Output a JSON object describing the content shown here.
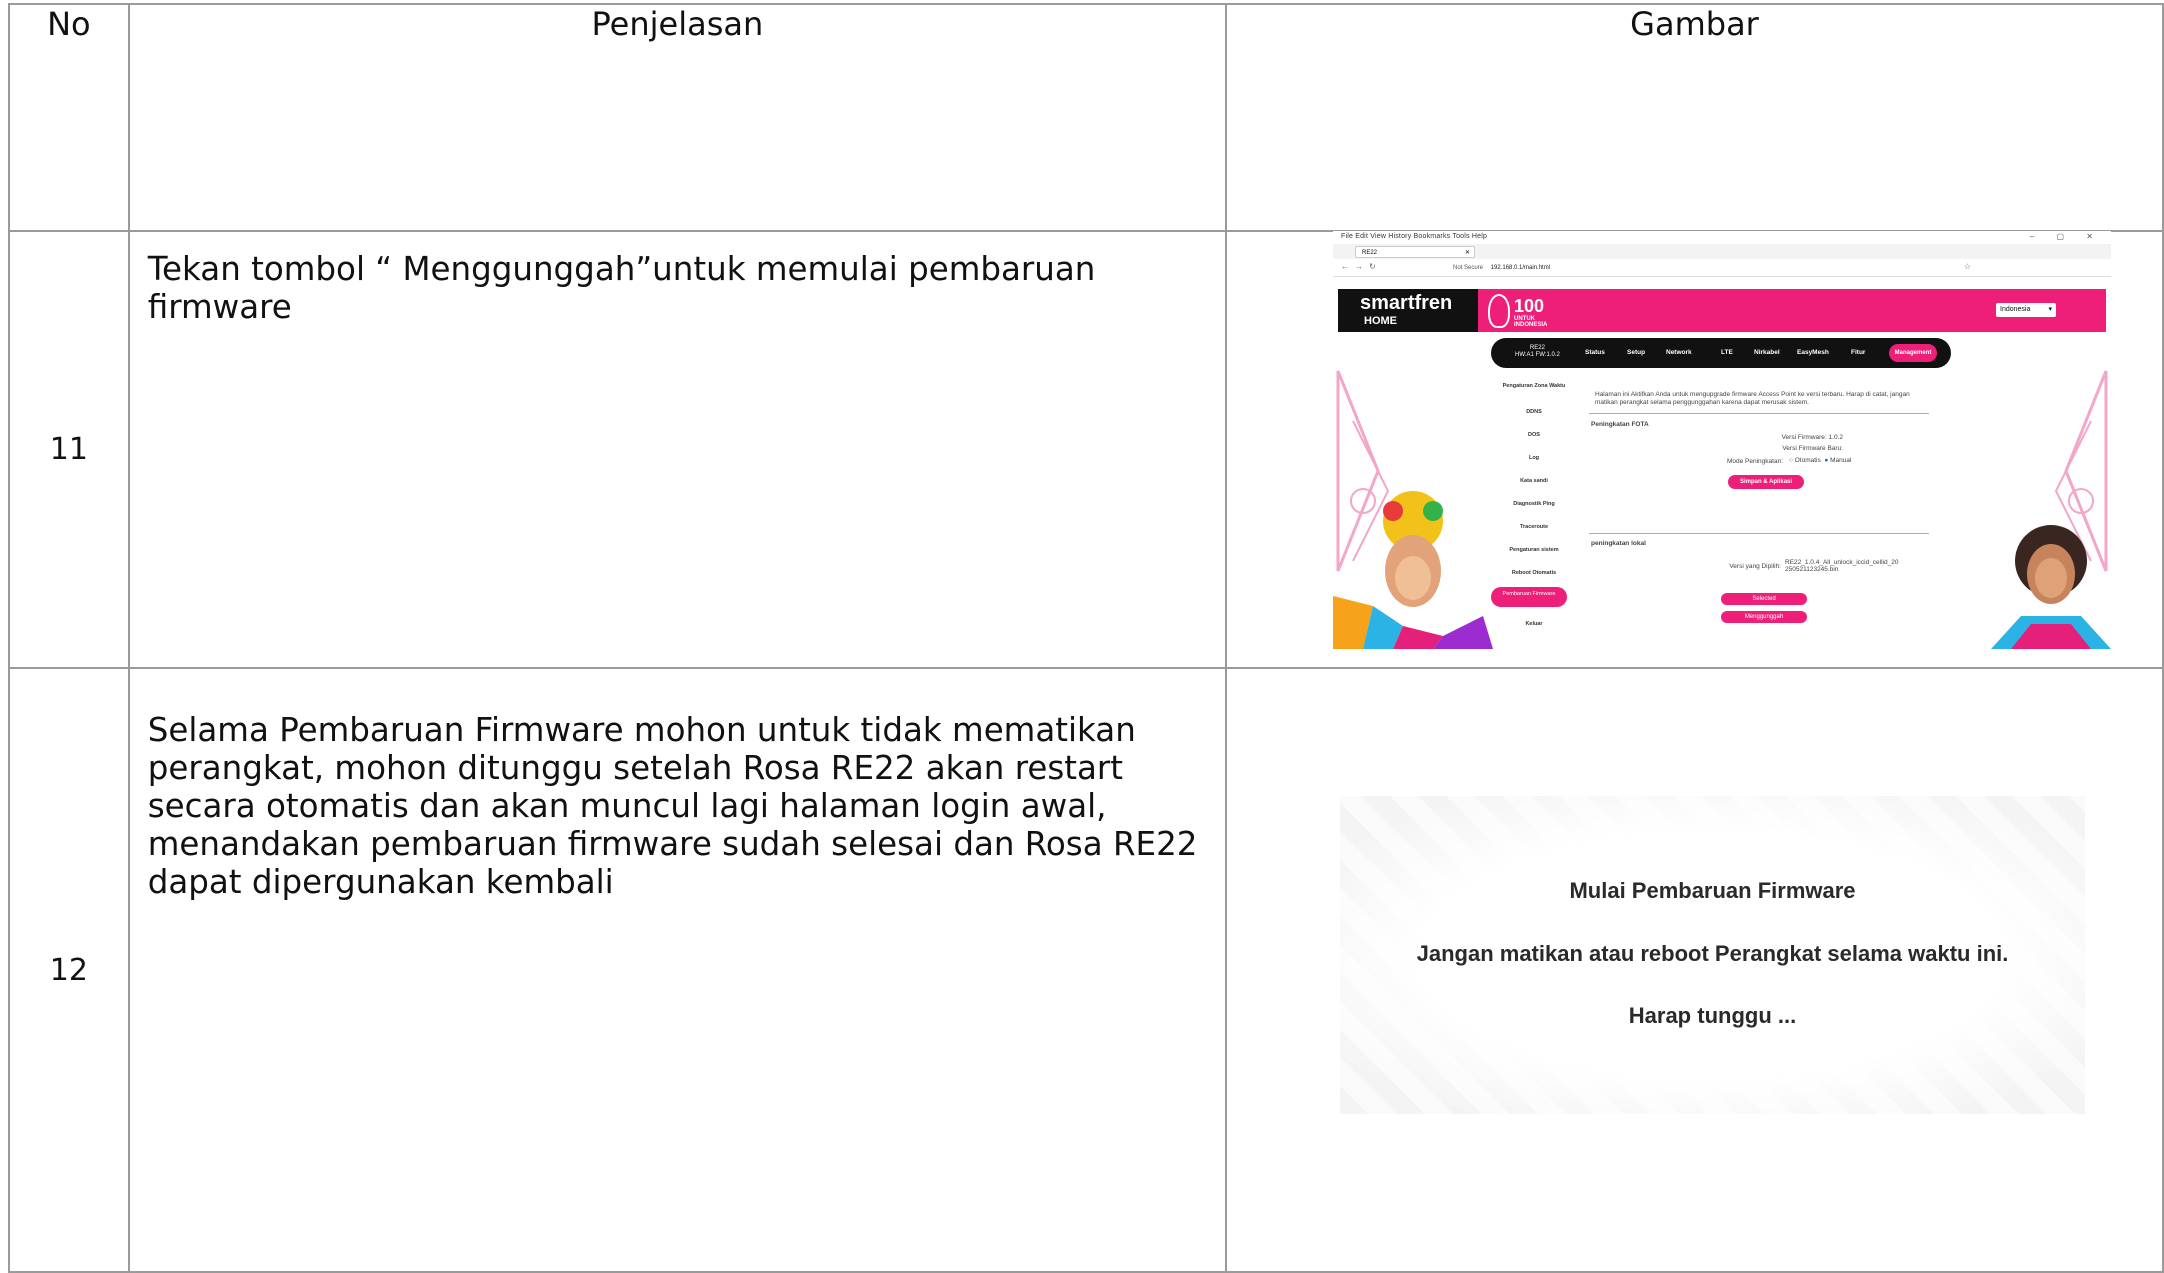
{
  "table": {
    "headers": {
      "no": "No",
      "description": "Penjelasan",
      "image": "Gambar"
    },
    "rows": [
      {
        "no": "11",
        "description": "Tekan tombol “ Menggunggah”untuk memulai pembaruan firmware"
      },
      {
        "no": "12",
        "description": "Selama Pembaruan Firmware mohon untuk tidak mematikan perangkat, mohon ditunggu setelah Rosa RE22 akan restart secara otomatis dan akan muncul lagi halaman login awal, menandakan pembaruan firmware sudah selesai dan Rosa RE22 dapat dipergunakan kembali"
      }
    ]
  },
  "screenshot1": {
    "browser": {
      "menu": "File  Edit  View  History  Bookmarks  Tools  Help",
      "tab_title": "RE22",
      "not_secure": "Not Secure",
      "url": "192.168.0.1/main.html"
    },
    "brand": {
      "name": "smartfren",
      "sub": "HOME",
      "badge_num": "100",
      "badge_text": "UNTUK INDONESIA"
    },
    "language": "Indonesia",
    "model": {
      "name": "RE22",
      "version": "HW:A1  FW:1.0.2"
    },
    "nav": [
      "Status",
      "Setup",
      "Network",
      "LTE",
      "Nirkabel",
      "EasyMesh",
      "Fitur",
      "Management"
    ],
    "sidebar": [
      "Pengaturan Zona Waktu",
      "DDNS",
      "DOS",
      "Log",
      "Kata sandi",
      "Diagnostik Ping",
      "Traceroute",
      "Pengaturan sistem",
      "Reboot Otomatis",
      "Pembaruan Firmware",
      "Keluar"
    ],
    "intro": "Halaman ini Aktifkan Anda untuk mengupgrade firmware Access Point ke versi terbaru. Harap di catat, jangan matikan perangkat selama penggunggahan karena dapat merusak sistem.",
    "fota": {
      "title": "Peningkatan FOTA",
      "current_label": "Versi Firmware: 1.0.2",
      "new_label": "Versi Firmware Baru:",
      "mode_label": "Mode Peningkatan:",
      "opt_auto": "Otomatis",
      "opt_manual": "Manual",
      "save_btn": "Simpan & Aplikasi"
    },
    "local": {
      "title": "peningkatan lokal",
      "selected_label": "Versi yang Dipilih:",
      "selected_file": "RE22_1.0.4_All_unlock_iccid_cellid_20250521123245.bin",
      "select_btn": "Selected",
      "upload_btn": "Menggunggah"
    }
  },
  "screenshot2": {
    "line1": "Mulai Pembaruan Firmware",
    "line2": "Jangan matikan atau reboot Perangkat selama waktu ini.",
    "line3": "Harap tunggu ..."
  }
}
